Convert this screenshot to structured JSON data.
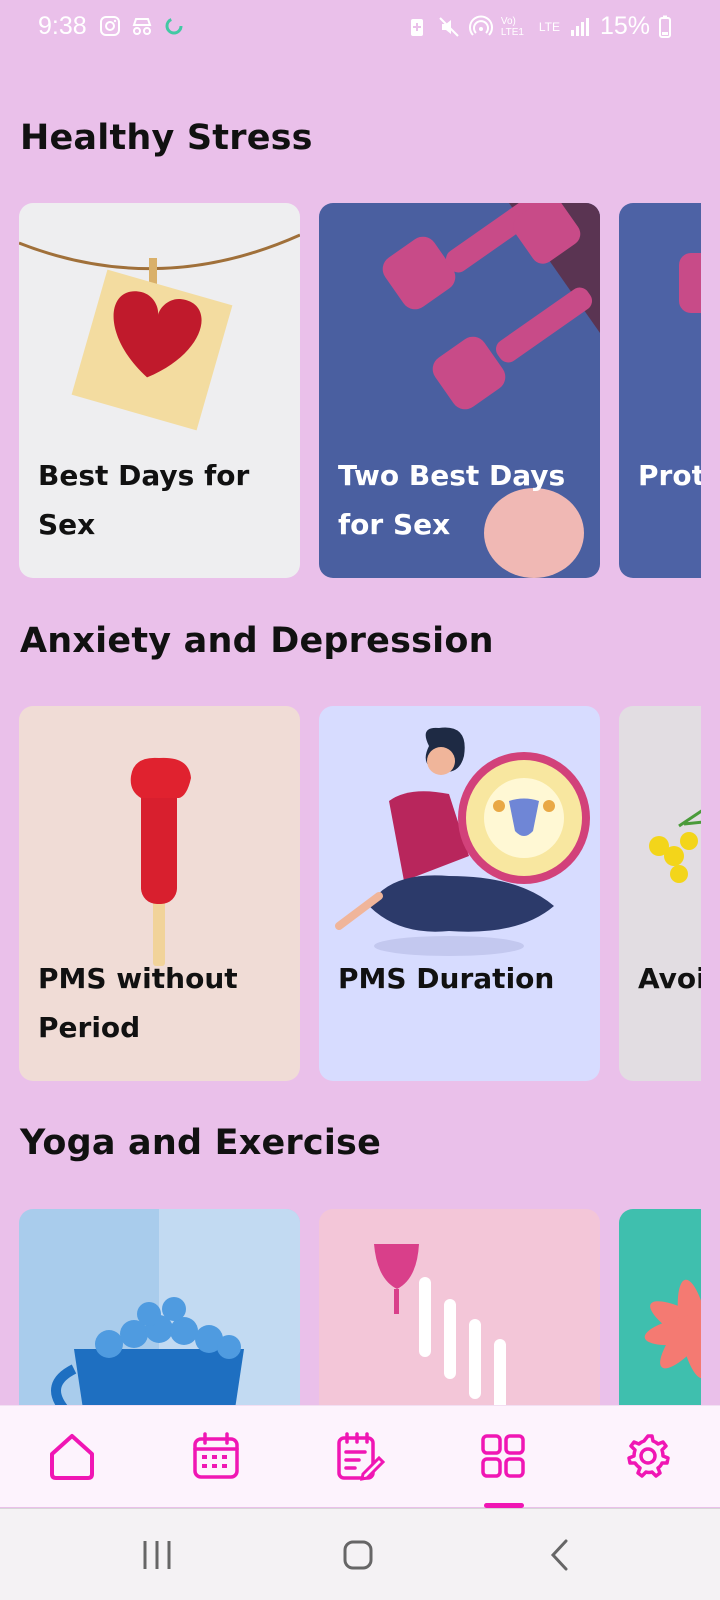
{
  "status_bar": {
    "time": "9:38",
    "battery": "15%",
    "left_icons": [
      "instagram-icon",
      "incognito-icon",
      "sync-circle-icon"
    ],
    "right_icons": [
      "battery-saver-icon",
      "mute-icon",
      "hotspot-icon",
      "volte-icon",
      "lte-icon",
      "signal-icon",
      "battery-icon"
    ],
    "network_label": "LTE",
    "volte_label": "Vo) LTE1"
  },
  "sections": [
    {
      "title": "Healthy Stress",
      "cards": [
        {
          "title": "Best Days for Sex",
          "image": "heart-on-string-image"
        },
        {
          "title": "Two Best Days for Sex",
          "image": "pink-dumbbells-image"
        },
        {
          "title": "Prot for C",
          "image": "blue-dumbbell-image"
        }
      ]
    },
    {
      "title": "Anxiety and Depression",
      "cards": [
        {
          "title": "PMS without Period",
          "image": "red-popsicle-image"
        },
        {
          "title": "PMS Duration",
          "image": "woman-uterus-illustration"
        },
        {
          "title": "Avoi Food",
          "image": "yellow-flowers-image"
        }
      ]
    },
    {
      "title": "Yoga and Exercise",
      "cards": [
        {
          "title": "",
          "image": "blue-cup-pills-image"
        },
        {
          "title": "",
          "image": "menstrual-cup-tampons-image"
        },
        {
          "title": "",
          "image": "pink-flower-image"
        }
      ]
    }
  ],
  "bottom_nav": {
    "items": [
      {
        "icon": "home-icon"
      },
      {
        "icon": "calendar-icon"
      },
      {
        "icon": "notes-icon"
      },
      {
        "icon": "grid-icon"
      },
      {
        "icon": "gear-icon"
      }
    ],
    "active_index": 3,
    "accent": "#f016b4"
  },
  "colors": {
    "background": "#eac0ea",
    "accent": "#f016b4"
  }
}
